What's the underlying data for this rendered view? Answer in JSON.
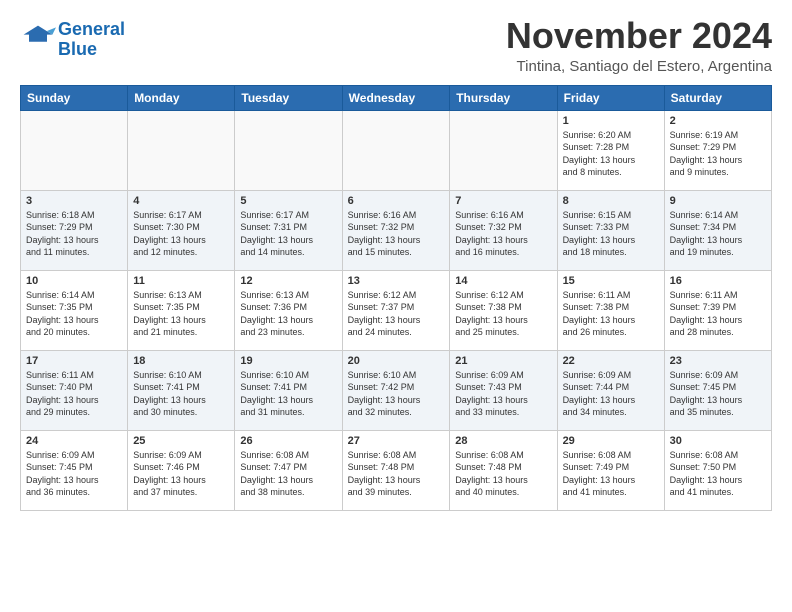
{
  "header": {
    "logo_line1": "General",
    "logo_line2": "Blue",
    "month_title": "November 2024",
    "subtitle": "Tintina, Santiago del Estero, Argentina"
  },
  "weekdays": [
    "Sunday",
    "Monday",
    "Tuesday",
    "Wednesday",
    "Thursday",
    "Friday",
    "Saturday"
  ],
  "weeks": [
    [
      {
        "day": "",
        "info": ""
      },
      {
        "day": "",
        "info": ""
      },
      {
        "day": "",
        "info": ""
      },
      {
        "day": "",
        "info": ""
      },
      {
        "day": "",
        "info": ""
      },
      {
        "day": "1",
        "info": "Sunrise: 6:20 AM\nSunset: 7:28 PM\nDaylight: 13 hours\nand 8 minutes."
      },
      {
        "day": "2",
        "info": "Sunrise: 6:19 AM\nSunset: 7:29 PM\nDaylight: 13 hours\nand 9 minutes."
      }
    ],
    [
      {
        "day": "3",
        "info": "Sunrise: 6:18 AM\nSunset: 7:29 PM\nDaylight: 13 hours\nand 11 minutes."
      },
      {
        "day": "4",
        "info": "Sunrise: 6:17 AM\nSunset: 7:30 PM\nDaylight: 13 hours\nand 12 minutes."
      },
      {
        "day": "5",
        "info": "Sunrise: 6:17 AM\nSunset: 7:31 PM\nDaylight: 13 hours\nand 14 minutes."
      },
      {
        "day": "6",
        "info": "Sunrise: 6:16 AM\nSunset: 7:32 PM\nDaylight: 13 hours\nand 15 minutes."
      },
      {
        "day": "7",
        "info": "Sunrise: 6:16 AM\nSunset: 7:32 PM\nDaylight: 13 hours\nand 16 minutes."
      },
      {
        "day": "8",
        "info": "Sunrise: 6:15 AM\nSunset: 7:33 PM\nDaylight: 13 hours\nand 18 minutes."
      },
      {
        "day": "9",
        "info": "Sunrise: 6:14 AM\nSunset: 7:34 PM\nDaylight: 13 hours\nand 19 minutes."
      }
    ],
    [
      {
        "day": "10",
        "info": "Sunrise: 6:14 AM\nSunset: 7:35 PM\nDaylight: 13 hours\nand 20 minutes."
      },
      {
        "day": "11",
        "info": "Sunrise: 6:13 AM\nSunset: 7:35 PM\nDaylight: 13 hours\nand 21 minutes."
      },
      {
        "day": "12",
        "info": "Sunrise: 6:13 AM\nSunset: 7:36 PM\nDaylight: 13 hours\nand 23 minutes."
      },
      {
        "day": "13",
        "info": "Sunrise: 6:12 AM\nSunset: 7:37 PM\nDaylight: 13 hours\nand 24 minutes."
      },
      {
        "day": "14",
        "info": "Sunrise: 6:12 AM\nSunset: 7:38 PM\nDaylight: 13 hours\nand 25 minutes."
      },
      {
        "day": "15",
        "info": "Sunrise: 6:11 AM\nSunset: 7:38 PM\nDaylight: 13 hours\nand 26 minutes."
      },
      {
        "day": "16",
        "info": "Sunrise: 6:11 AM\nSunset: 7:39 PM\nDaylight: 13 hours\nand 28 minutes."
      }
    ],
    [
      {
        "day": "17",
        "info": "Sunrise: 6:11 AM\nSunset: 7:40 PM\nDaylight: 13 hours\nand 29 minutes."
      },
      {
        "day": "18",
        "info": "Sunrise: 6:10 AM\nSunset: 7:41 PM\nDaylight: 13 hours\nand 30 minutes."
      },
      {
        "day": "19",
        "info": "Sunrise: 6:10 AM\nSunset: 7:41 PM\nDaylight: 13 hours\nand 31 minutes."
      },
      {
        "day": "20",
        "info": "Sunrise: 6:10 AM\nSunset: 7:42 PM\nDaylight: 13 hours\nand 32 minutes."
      },
      {
        "day": "21",
        "info": "Sunrise: 6:09 AM\nSunset: 7:43 PM\nDaylight: 13 hours\nand 33 minutes."
      },
      {
        "day": "22",
        "info": "Sunrise: 6:09 AM\nSunset: 7:44 PM\nDaylight: 13 hours\nand 34 minutes."
      },
      {
        "day": "23",
        "info": "Sunrise: 6:09 AM\nSunset: 7:45 PM\nDaylight: 13 hours\nand 35 minutes."
      }
    ],
    [
      {
        "day": "24",
        "info": "Sunrise: 6:09 AM\nSunset: 7:45 PM\nDaylight: 13 hours\nand 36 minutes."
      },
      {
        "day": "25",
        "info": "Sunrise: 6:09 AM\nSunset: 7:46 PM\nDaylight: 13 hours\nand 37 minutes."
      },
      {
        "day": "26",
        "info": "Sunrise: 6:08 AM\nSunset: 7:47 PM\nDaylight: 13 hours\nand 38 minutes."
      },
      {
        "day": "27",
        "info": "Sunrise: 6:08 AM\nSunset: 7:48 PM\nDaylight: 13 hours\nand 39 minutes."
      },
      {
        "day": "28",
        "info": "Sunrise: 6:08 AM\nSunset: 7:48 PM\nDaylight: 13 hours\nand 40 minutes."
      },
      {
        "day": "29",
        "info": "Sunrise: 6:08 AM\nSunset: 7:49 PM\nDaylight: 13 hours\nand 41 minutes."
      },
      {
        "day": "30",
        "info": "Sunrise: 6:08 AM\nSunset: 7:50 PM\nDaylight: 13 hours\nand 41 minutes."
      }
    ]
  ]
}
